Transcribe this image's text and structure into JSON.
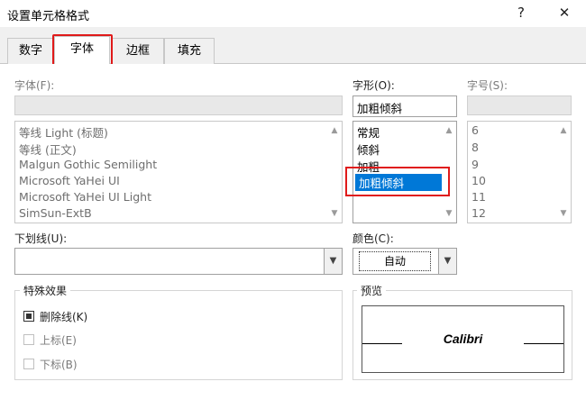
{
  "window": {
    "title": "设置单元格格式",
    "help_glyph": "?",
    "close_glyph": "✕"
  },
  "tabs": [
    {
      "label": "数字"
    },
    {
      "label": "字体"
    },
    {
      "label": "边框"
    },
    {
      "label": "填充"
    }
  ],
  "font": {
    "label": "字体(F):",
    "value": "",
    "items": [
      "等线 Light (标题)",
      "等线 (正文)",
      "Malgun Gothic Semilight",
      "Microsoft YaHei UI",
      "Microsoft YaHei UI Light",
      "SimSun-ExtB"
    ]
  },
  "style": {
    "label": "字形(O):",
    "value": "加粗倾斜",
    "items": [
      "常规",
      "倾斜",
      "加粗",
      "加粗倾斜"
    ],
    "selected": "加粗倾斜"
  },
  "size": {
    "label": "字号(S):",
    "value": "",
    "items": [
      "6",
      "8",
      "9",
      "10",
      "11",
      "12"
    ]
  },
  "underline": {
    "label": "下划线(U):",
    "value": ""
  },
  "color": {
    "label": "颜色(C):",
    "value": "自动"
  },
  "effects": {
    "legend": "特殊效果",
    "items": [
      {
        "label": "删除线(K)",
        "checked": true,
        "enabled": true
      },
      {
        "label": "上标(E)",
        "checked": false,
        "enabled": false
      },
      {
        "label": "下标(B)",
        "checked": false,
        "enabled": false
      }
    ]
  },
  "preview": {
    "legend": "预览",
    "sample": "Calibri"
  },
  "colors": {
    "highlight_red": "#e01a1a",
    "selection_blue": "#0078d7"
  },
  "icons": {
    "scroll_up": "up-arrow",
    "scroll_down": "down-arrow",
    "dropdown": "chevron-down"
  }
}
